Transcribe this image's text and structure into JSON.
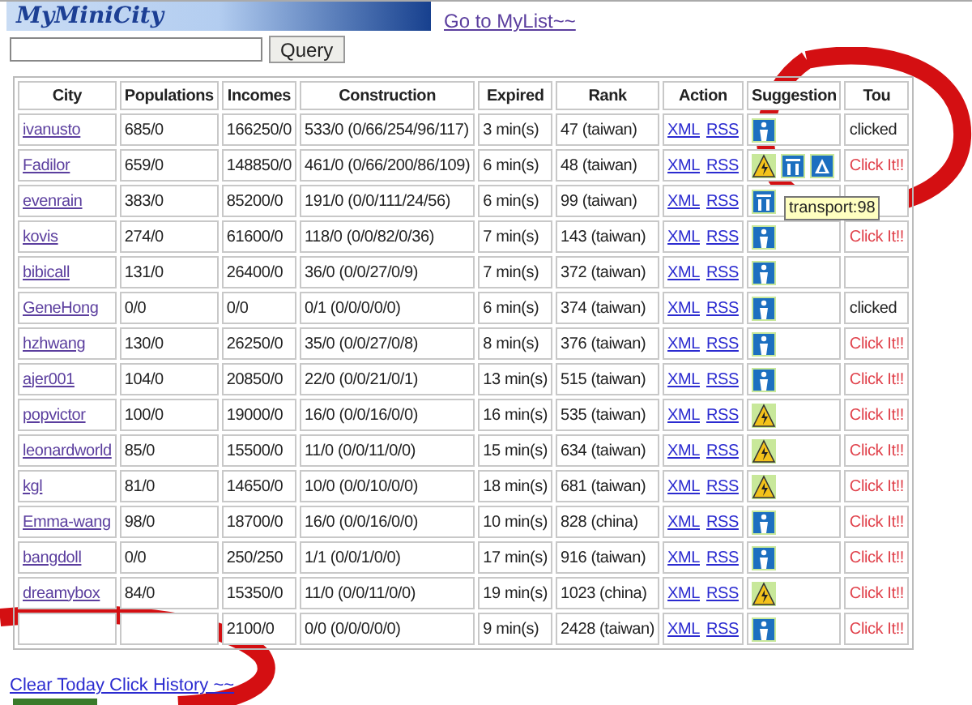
{
  "header": {
    "logo": "MyMiniCity",
    "mylist_link": "Go to MyList~~",
    "query_button": "Query"
  },
  "table": {
    "columns": [
      "City",
      "Populations",
      "Incomes",
      "Construction",
      "Expired",
      "Rank",
      "Action",
      "Suggestion",
      "Tou"
    ],
    "rows": [
      {
        "city": "ivanusto",
        "population": "685/0",
        "incomes": "166250/0",
        "construction": "533/0 (0/66/254/96/117)",
        "expired": "3 min(s)",
        "rank": "47 (taiwan)",
        "actions": [
          "XML",
          "RSS"
        ],
        "suggestions": [
          {
            "kind": "person"
          }
        ],
        "tour": {
          "text": "clicked",
          "kind": "clicked"
        }
      },
      {
        "city": "Fadilor",
        "population": "659/0",
        "incomes": "148850/0",
        "construction": "461/0 (0/66/200/86/109)",
        "expired": "6 min(s)",
        "rank": "48 (taiwan)",
        "actions": [
          "XML",
          "RSS"
        ],
        "suggestions": [
          {
            "kind": "warning"
          },
          {
            "kind": "transport"
          },
          {
            "kind": "road"
          }
        ],
        "tour": {
          "text": "Click It!!",
          "kind": "link"
        }
      },
      {
        "city": "evenrain",
        "population": "383/0",
        "incomes": "85200/0",
        "construction": "191/0 (0/0/111/24/56)",
        "expired": "6 min(s)",
        "rank": "99 (taiwan)",
        "actions": [
          "XML",
          "RSS"
        ],
        "suggestions": [
          {
            "kind": "transport"
          }
        ],
        "tooltip": "transport:98"
      },
      {
        "city": "kovis",
        "population": "274/0",
        "incomes": "61600/0",
        "construction": "118/0 (0/0/82/0/36)",
        "expired": "7 min(s)",
        "rank": "143 (taiwan)",
        "actions": [
          "XML",
          "RSS"
        ],
        "suggestions": [
          {
            "kind": "person"
          }
        ],
        "tour": {
          "text": "Click It!!",
          "kind": "link"
        }
      },
      {
        "city": "bibicall",
        "population": "131/0",
        "incomes": "26400/0",
        "construction": "36/0 (0/0/27/0/9)",
        "expired": "7 min(s)",
        "rank": "372 (taiwan)",
        "actions": [
          "XML",
          "RSS"
        ],
        "suggestions": [
          {
            "kind": "person"
          }
        ]
      },
      {
        "city": "GeneHong",
        "population": "0/0",
        "incomes": "0/0",
        "construction": "0/1 (0/0/0/0/0)",
        "expired": "6 min(s)",
        "rank": "374 (taiwan)",
        "actions": [
          "XML",
          "RSS"
        ],
        "suggestions": [
          {
            "kind": "person"
          }
        ],
        "tour": {
          "text": "clicked",
          "kind": "clicked"
        }
      },
      {
        "city": "hzhwang",
        "population": "130/0",
        "incomes": "26250/0",
        "construction": "35/0 (0/0/27/0/8)",
        "expired": "8 min(s)",
        "rank": "376 (taiwan)",
        "actions": [
          "XML",
          "RSS"
        ],
        "suggestions": [
          {
            "kind": "person"
          }
        ],
        "tour": {
          "text": "Click It!!",
          "kind": "link"
        }
      },
      {
        "city": "ajer001",
        "population": "104/0",
        "incomes": "20850/0",
        "construction": "22/0 (0/0/21/0/1)",
        "expired": "13 min(s)",
        "rank": "515 (taiwan)",
        "actions": [
          "XML",
          "RSS"
        ],
        "suggestions": [
          {
            "kind": "person"
          }
        ],
        "tour": {
          "text": "Click It!!",
          "kind": "link"
        }
      },
      {
        "city": "popvictor",
        "population": "100/0",
        "incomes": "19000/0",
        "construction": "16/0 (0/0/16/0/0)",
        "expired": "16 min(s)",
        "rank": "535 (taiwan)",
        "actions": [
          "XML",
          "RSS"
        ],
        "suggestions": [
          {
            "kind": "warning"
          }
        ],
        "tour": {
          "text": "Click It!!",
          "kind": "link"
        }
      },
      {
        "city": "leonardworld",
        "population": "85/0",
        "incomes": "15500/0",
        "construction": "11/0 (0/0/11/0/0)",
        "expired": "15 min(s)",
        "rank": "634 (taiwan)",
        "actions": [
          "XML",
          "RSS"
        ],
        "suggestions": [
          {
            "kind": "warning"
          }
        ],
        "tour": {
          "text": "Click It!!",
          "kind": "link"
        }
      },
      {
        "city": "kgl",
        "population": "81/0",
        "incomes": "14650/0",
        "construction": "10/0 (0/0/10/0/0)",
        "expired": "18 min(s)",
        "rank": "681 (taiwan)",
        "actions": [
          "XML",
          "RSS"
        ],
        "suggestions": [
          {
            "kind": "warning"
          }
        ],
        "tour": {
          "text": "Click It!!",
          "kind": "link"
        }
      },
      {
        "city": "Emma-wang",
        "population": "98/0",
        "incomes": "18700/0",
        "construction": "16/0 (0/0/16/0/0)",
        "expired": "10 min(s)",
        "rank": "828 (china)",
        "actions": [
          "XML",
          "RSS"
        ],
        "suggestions": [
          {
            "kind": "person"
          }
        ],
        "tour": {
          "text": "Click It!!",
          "kind": "link"
        }
      },
      {
        "city": "bangdoll",
        "population": "0/0",
        "incomes": "250/250",
        "construction": "1/1 (0/0/1/0/0)",
        "expired": "17 min(s)",
        "rank": "916 (taiwan)",
        "actions": [
          "XML",
          "RSS"
        ],
        "suggestions": [
          {
            "kind": "person"
          }
        ],
        "tour": {
          "text": "Click It!!",
          "kind": "link"
        }
      },
      {
        "city": "dreamybox",
        "population": "84/0",
        "incomes": "15350/0",
        "construction": "11/0 (0/0/11/0/0)",
        "expired": "19 min(s)",
        "rank": "1023 (china)",
        "actions": [
          "XML",
          "RSS"
        ],
        "suggestions": [
          {
            "kind": "warning"
          }
        ],
        "tour": {
          "text": "Click It!!",
          "kind": "link"
        }
      },
      {
        "incomes": "2100/0",
        "construction": "0/0 (0/0/0/0/0)",
        "expired": "9 min(s)",
        "rank": "2428 (taiwan)",
        "actions": [
          "XML",
          "RSS"
        ],
        "suggestions": [
          {
            "kind": "person"
          }
        ],
        "tour": {
          "text": "Click It!!",
          "kind": "link"
        }
      }
    ]
  },
  "footer": {
    "clear_link": "Clear Today Click History ~~"
  }
}
